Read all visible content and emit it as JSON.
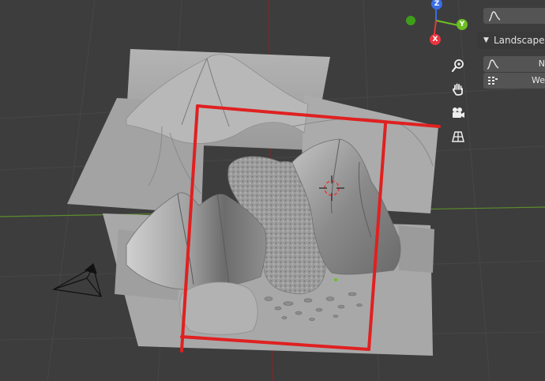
{
  "gizmo": {
    "z_label": "Z",
    "y_label": "Y",
    "x_label": "X",
    "colors": {
      "x": "#e8353f",
      "y": "#6cbf23",
      "z": "#3a6ee6",
      "neg_y": "#3e9e1a"
    }
  },
  "nav_buttons": [
    {
      "name": "zoom-button",
      "icon": "magnifier-zoom-icon"
    },
    {
      "name": "pan-button",
      "icon": "hand-pan-icon"
    },
    {
      "name": "camera-view-button",
      "icon": "camera-icon"
    },
    {
      "name": "perspective-toggle-button",
      "icon": "grid-perspective-icon"
    }
  ],
  "sidebar": {
    "top_field_icon": "curve-icon",
    "panel_title": "Landscape T",
    "rows": [
      {
        "icon": "curve-icon",
        "text": "N"
      },
      {
        "icon": "data-grid-icon",
        "text": "We"
      }
    ]
  },
  "annotation": {
    "color": "#e02020"
  },
  "axis_colors": {
    "x": "#7a2a2a",
    "y": "#5b8e2c"
  },
  "terrain_color": "#a6a6a6"
}
